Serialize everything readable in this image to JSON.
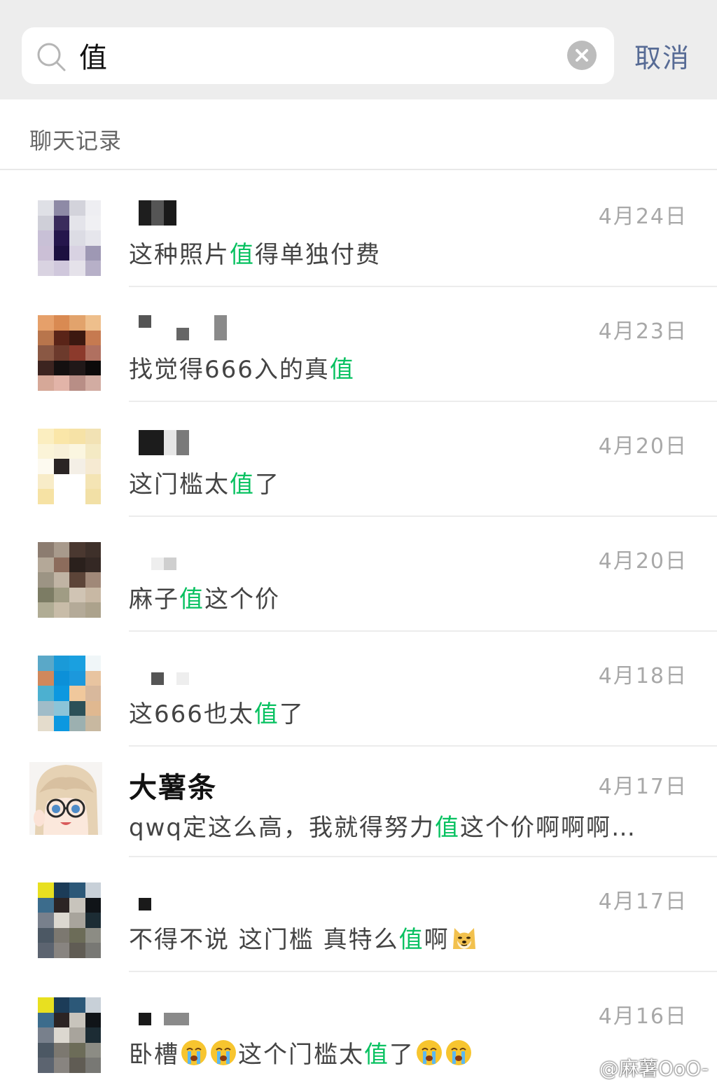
{
  "search": {
    "query": "值",
    "cancel_label": "取消"
  },
  "section": {
    "title": "聊天记录"
  },
  "colors": {
    "highlight": "#07c160",
    "cancel": "#576b95"
  },
  "results": [
    {
      "name": "",
      "date": "4月24日",
      "pre": "这种照片",
      "hl": "值",
      "post": "得单独付费",
      "emoji_count": 0
    },
    {
      "name": "",
      "date": "4月23日",
      "pre": "找觉得666入的真",
      "hl": "值",
      "post": "",
      "emoji_count": 0
    },
    {
      "name": "",
      "date": "4月20日",
      "pre": "这门槛太",
      "hl": "值",
      "post": "了",
      "emoji_count": 0
    },
    {
      "name": "",
      "date": "4月20日",
      "pre": "麻子",
      "hl": "值",
      "post": "这个价",
      "emoji_count": 0
    },
    {
      "name": "",
      "date": "4月18日",
      "pre": "这666也太",
      "hl": "值",
      "post": "了",
      "emoji_count": 0
    },
    {
      "name": "大薯条",
      "date": "4月17日",
      "pre": "qwq定这么高，我就得努力",
      "hl": "值",
      "post": "这个价啊啊啊…",
      "emoji_count": 0
    },
    {
      "name": "",
      "date": "4月17日",
      "pre": "不得不说 这门槛 真特么",
      "hl": "值",
      "post": "啊",
      "emoji": "doge-emoji"
    },
    {
      "name": "",
      "date": "4月16日",
      "pre": "卧槽",
      "hl": "值",
      "post": "这个门槛太",
      "tail": "了",
      "emoji": "crying-emoji"
    }
  ],
  "watermark": {
    "text": "@麻薯OoO-"
  }
}
